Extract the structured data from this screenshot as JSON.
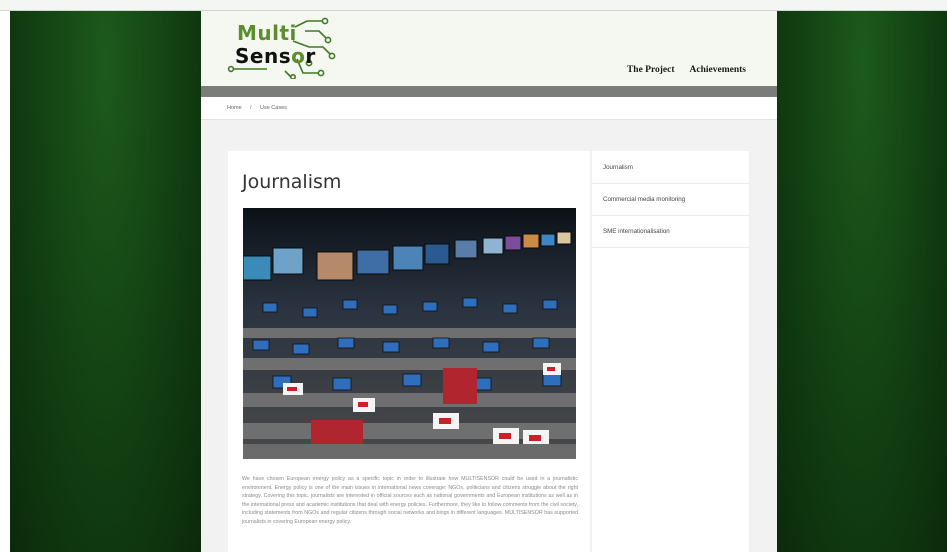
{
  "header": {
    "logo_part1": "Multi",
    "logo_part2": "Sens",
    "logo_part3": "r",
    "nav": [
      "The Project",
      "Achievements"
    ]
  },
  "breadcrumb": {
    "home": "Home",
    "separator": "/",
    "current": "Use Cases"
  },
  "main": {
    "title": "Journalism",
    "image_alt": "Newsroom with many monitors",
    "paragraph": "We have chosen European energy policy as a specific topic in order to illustrate how MULTISENSOR could be used in a journalistic environment. Energy policy is one of the main issues in international news coverage; NGOs, politicians and citizens struggle about the right strategy. Covering this topic, journalists are interested in official sources such as national governments and European institutions as well as in the international press and academic institutions that deal with energy policies. Furthermore, they like to follow comments from the civil society, including statements from NGOs and regular citizens through social networks and blogs in different languages. MULTISENSOR has supported journalists in covering European energy policy."
  },
  "sidebar": {
    "items": [
      {
        "label": "Journalism"
      },
      {
        "label": "Commercial media monitoring"
      },
      {
        "label": "SME internationalisation"
      }
    ]
  },
  "colors": {
    "background_green": "#123f12",
    "logo_accent": "#5c8d2f",
    "header_bar": "#7a7d7a"
  },
  "icons": {
    "logo": "circuit-node-logo"
  }
}
